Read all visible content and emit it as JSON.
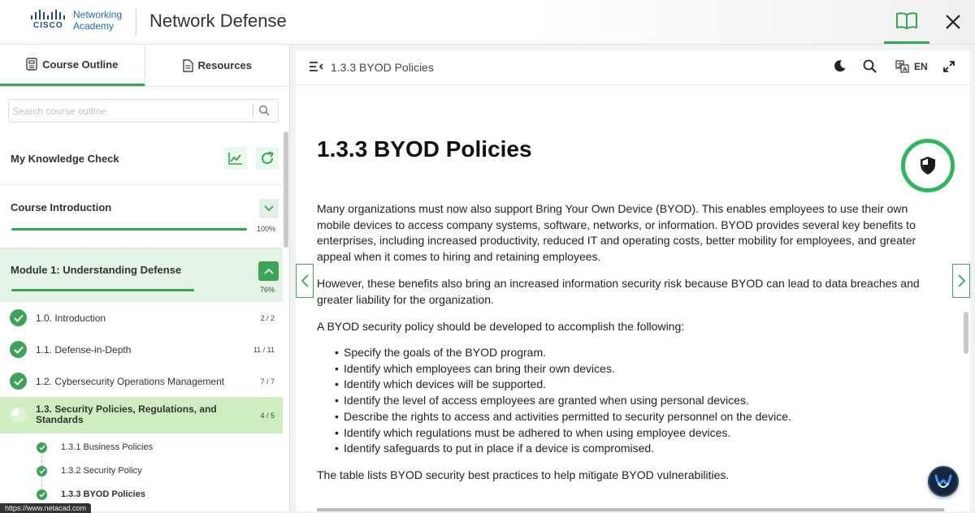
{
  "header": {
    "brand_cisco": "CISCO",
    "brand_line1": "Networking",
    "brand_line2": "Academy",
    "title": "Network Defense"
  },
  "sidebar": {
    "tabs": [
      {
        "label": "Course Outline",
        "icon": "outline-icon",
        "active": true
      },
      {
        "label": "Resources",
        "icon": "document-icon",
        "active": false
      }
    ],
    "search": {
      "placeholder": "Search course outline",
      "value": ""
    },
    "knowledge_check": {
      "label": "My Knowledge Check"
    },
    "course_intro": {
      "label": "Course Introduction",
      "progress": "100%",
      "progress_value": 1.0
    },
    "module": {
      "label": "Module 1: Understanding Defense",
      "progress": "76%",
      "progress_value": 0.76
    },
    "items": [
      {
        "label": "1.0. Introduction",
        "count": "2 / 2"
      },
      {
        "label": "1.1. Defense-in-Depth",
        "count": "11 / 11"
      },
      {
        "label": "1.2. Cybersecurity Operations Management",
        "count": "7 / 7"
      },
      {
        "label": "1.3. Security Policies, Regulations, and Standards",
        "count": "4 / 5"
      }
    ],
    "subitems": [
      {
        "label": "1.3.1 Business Policies"
      },
      {
        "label": "1.3.2 Security Policy"
      },
      {
        "label": "1.3.3 BYOD Policies"
      }
    ],
    "status_url": "https://www.netacad.com"
  },
  "main": {
    "breadcrumb": "1.3.3 BYOD Policies",
    "language": "EN",
    "heading": "1.3.3 BYOD Policies",
    "paragraph1": "Many organizations must now also support Bring Your Own Device (BYOD). This enables employees to use their own mobile devices to access company systems, software, networks, or information. BYOD provides several key benefits to enterprises, including increased productivity, reduced IT and operating costs, better mobility for employees, and greater appeal when it comes to hiring and retaining employees.",
    "paragraph2": "However, these benefits also bring an increased information security risk because BYOD can lead to data breaches and greater liability for the organization.",
    "paragraph3": "A BYOD security policy should be developed to accomplish the following:",
    "bullets": [
      "Specify the goals of the BYOD program.",
      "Identify which employees can bring their own devices.",
      "Identify which devices will be supported.",
      "Identify the level of access employees are granted when using personal devices.",
      "Describe the rights to access and activities permitted to security personnel on the device.",
      "Identify which regulations must be adhered to when using employee devices.",
      "Identify safeguards to put in place if a device is compromised."
    ],
    "paragraph4": "The table lists BYOD security best practices to help mitigate BYOD vulnerabilities."
  },
  "colors": {
    "accent": "#2fa84f",
    "module_bg": "#e3f3e5",
    "active_item_bg": "#cfeec0",
    "brand": "#1a4a8a"
  }
}
